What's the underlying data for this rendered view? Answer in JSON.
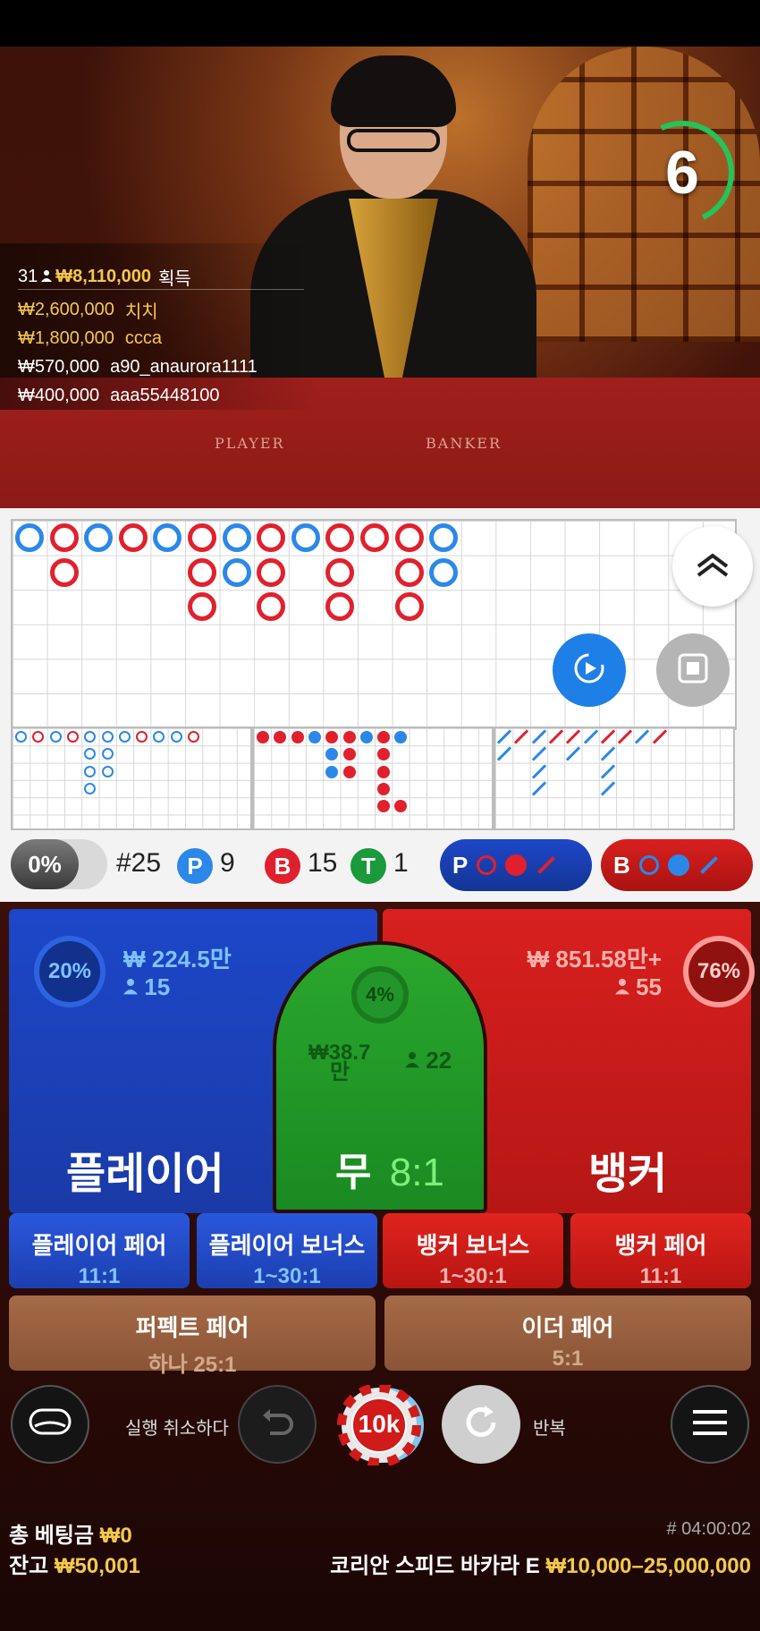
{
  "timer": {
    "value": "6"
  },
  "winners": {
    "count": "31",
    "total": "₩8,110,000",
    "total_label": "획득",
    "rows": [
      {
        "amount": "₩2,600,000",
        "name": "치치",
        "highlight": true
      },
      {
        "amount": "₩1,800,000",
        "name": "ccca",
        "highlight": true
      },
      {
        "amount": "₩570,000",
        "name": "a90_anaurora1111",
        "highlight": false
      },
      {
        "amount": "₩400,000",
        "name": "aaa55448100",
        "highlight": false
      }
    ]
  },
  "table_labels": {
    "player": "PLAYER",
    "banker": "BANKER"
  },
  "stats": {
    "percent": "0%",
    "round": "#25",
    "player_icon": "P",
    "player_count": "9",
    "banker_icon": "B",
    "banker_count": "15",
    "tie_icon": "T",
    "tie_count": "1",
    "predict_player": "P",
    "predict_banker": "B"
  },
  "bets": {
    "player": {
      "percent": "20%",
      "amount": "₩ 224.5만",
      "players": "15",
      "title": "플레이어"
    },
    "tie": {
      "percent": "4%",
      "amount_line1": "₩38.7",
      "amount_line2": "만",
      "players": "22",
      "title": "무",
      "payout": "8:1"
    },
    "banker": {
      "percent": "76%",
      "amount": "₩ 851.58만+",
      "players": "55",
      "title": "뱅커"
    }
  },
  "side_bets": [
    {
      "label": "플레이어 페어",
      "payout": "11:1"
    },
    {
      "label": "플레이어 보너스",
      "payout": "1~30:1"
    },
    {
      "label": "뱅커 보너스",
      "payout": "1~30:1"
    },
    {
      "label": "뱅커 페어",
      "payout": "11:1"
    }
  ],
  "pair_bets": [
    {
      "label": "퍼펙트 페어",
      "payout": "하나 25:1"
    },
    {
      "label": "이더 페어",
      "payout": "5:1"
    }
  ],
  "controls": {
    "undo_label": "실행 취소하다",
    "chip_value": "10k",
    "repeat_label": "반복"
  },
  "footer": {
    "total_bet_label": "총 베팅금",
    "total_bet_value": "₩0",
    "balance_label": "잔고",
    "balance_value": "₩50,001",
    "round_id": "# 04:00:02",
    "table_name": "코리안 스피드 바카라 E",
    "limits": "₩10,000–25,000,000"
  },
  "colors": {
    "player_blue": "#1d47c9",
    "banker_red": "#d8201f",
    "tie_green": "#2aa72d",
    "gold": "#f4c94a"
  },
  "icons": [
    "timer-ring",
    "person-icon",
    "collapse-up-icon",
    "replay-video-icon",
    "stop-video-icon",
    "chat-icon",
    "undo-icon",
    "repeat-icon",
    "menu-icon"
  ],
  "big_road": [
    {
      "col": 0,
      "row": 0,
      "r": "p"
    },
    {
      "col": 1,
      "row": 0,
      "r": "b"
    },
    {
      "col": 1,
      "row": 1,
      "r": "b"
    },
    {
      "col": 2,
      "row": 0,
      "r": "p"
    },
    {
      "col": 3,
      "row": 0,
      "r": "b"
    },
    {
      "col": 4,
      "row": 0,
      "r": "p"
    },
    {
      "col": 5,
      "row": 0,
      "r": "b"
    },
    {
      "col": 5,
      "row": 1,
      "r": "b"
    },
    {
      "col": 5,
      "row": 2,
      "r": "b"
    },
    {
      "col": 6,
      "row": 0,
      "r": "p"
    },
    {
      "col": 6,
      "row": 1,
      "r": "p"
    },
    {
      "col": 7,
      "row": 0,
      "r": "b"
    },
    {
      "col": 7,
      "row": 1,
      "r": "b"
    },
    {
      "col": 7,
      "row": 2,
      "r": "b"
    },
    {
      "col": 8,
      "row": 0,
      "r": "p"
    },
    {
      "col": 9,
      "row": 0,
      "r": "b"
    },
    {
      "col": 9,
      "row": 1,
      "r": "b"
    },
    {
      "col": 9,
      "row": 2,
      "r": "b"
    },
    {
      "col": 10,
      "row": 0,
      "r": "b"
    },
    {
      "col": 11,
      "row": 0,
      "r": "b"
    },
    {
      "col": 11,
      "row": 1,
      "r": "b"
    },
    {
      "col": 11,
      "row": 2,
      "r": "b"
    },
    {
      "col": 12,
      "row": 0,
      "r": "p"
    },
    {
      "col": 12,
      "row": 1,
      "r": "p"
    }
  ]
}
